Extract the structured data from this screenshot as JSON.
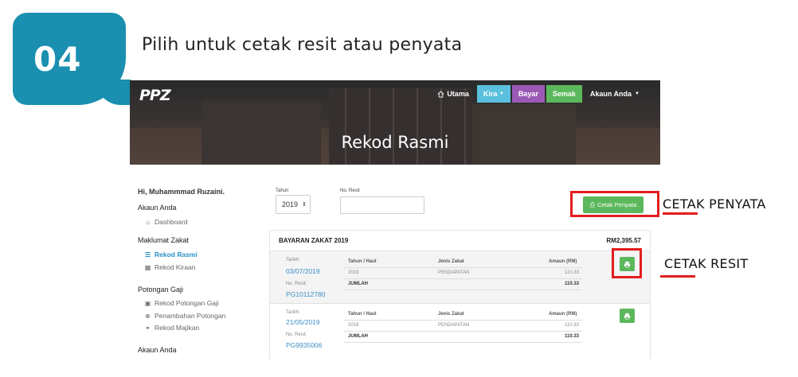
{
  "step": {
    "number": "04",
    "title": "Pilih untuk cetak resit atau penyata"
  },
  "header": {
    "brand": "PPZ",
    "nav": {
      "home_label": "Utama",
      "kira_label": "Kira",
      "bayar_label": "Bayar",
      "semak_label": "Semak",
      "akaun_label": "Akaun Anda"
    },
    "page_title": "Rekod Rasmi"
  },
  "sidebar": {
    "greeting": "Hi, Muhammmad Ruzaini.",
    "sections": [
      {
        "heading": "Akaun Anda",
        "items": [
          {
            "label": "Dashboard",
            "icon": "home-icon"
          }
        ]
      },
      {
        "heading": "Maklumat Zakat",
        "items": [
          {
            "label": "Rekod Rasmi",
            "icon": "list-icon",
            "active": true
          },
          {
            "label": "Rekod Kiraan",
            "icon": "calculator-icon"
          }
        ]
      },
      {
        "heading": "Potongan Gaji",
        "items": [
          {
            "label": "Rekod Potongan Gaji",
            "icon": "briefcase-icon"
          },
          {
            "label": "Penambahan Potongan",
            "icon": "plus-circle-icon"
          },
          {
            "label": "Rekod Majikan",
            "icon": "sitemap-icon"
          }
        ]
      },
      {
        "heading": "Akaun Anda",
        "items": []
      }
    ]
  },
  "filters": {
    "tahun_label": "Tahun",
    "tahun_value": "2019",
    "resit_label": "No. Resit",
    "resit_value": "",
    "cetak_penyata_label": "Cetak Penyata"
  },
  "summary": {
    "title": "BAYARAN ZAKAT 2019",
    "total": "RM2,395.57"
  },
  "records": [
    {
      "tarikh_label": "Tarikh:",
      "tarikh": "03/07/2019",
      "resit_label": "No. Resit:",
      "resit": "PG10112780",
      "columns": [
        "Tahun / Haul",
        "Jenis Zakat",
        "Amaun (RM)"
      ],
      "row": [
        "2019",
        "PENDAPATAN",
        "110.33"
      ],
      "total_label": "JUMLAH",
      "total": "110.33"
    },
    {
      "tarikh_label": "Tarikh:",
      "tarikh": "21/05/2019",
      "resit_label": "No. Resit:",
      "resit": "PG9935006",
      "columns": [
        "Tahun / Haul",
        "Jenis Zakat",
        "Amaun (RM)"
      ],
      "row": [
        "2019",
        "PENDAPATAN",
        "110.33"
      ],
      "total_label": "JUMLAH",
      "total": "110.33"
    }
  ],
  "annotations": {
    "penyata": "CETAK PENYATA",
    "resit": "CETAK RESIT",
    "highlight_color": "#e31d1d"
  },
  "colors": {
    "badge": "#1a8fb0",
    "green": "#5cb85c",
    "kira": "#5bc0de",
    "bayar": "#9b59b6",
    "link": "#3a8fc6"
  }
}
